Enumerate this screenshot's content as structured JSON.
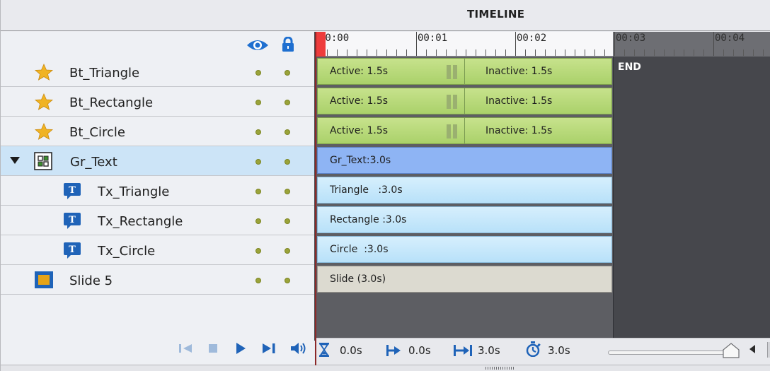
{
  "panel": {
    "title": "TIMELINE"
  },
  "header_icons": {
    "visibility": "eye-icon",
    "lock": "lock-icon"
  },
  "ruler": {
    "ticks": [
      "00:00",
      "00:01",
      "00:02",
      "00:03",
      "00:04"
    ]
  },
  "end_label": "END",
  "layers": [
    {
      "name": "Bt_Triangle",
      "icon": "star-icon",
      "indent": 0
    },
    {
      "name": "Bt_Rectangle",
      "icon": "star-icon",
      "indent": 0
    },
    {
      "name": "Bt_Circle",
      "icon": "star-icon",
      "indent": 0
    },
    {
      "name": "Gr_Text",
      "icon": "group-icon",
      "indent": 0,
      "expanded": true,
      "selected": true
    },
    {
      "name": "Tx_Triangle",
      "icon": "text-caption-icon",
      "indent": 1
    },
    {
      "name": "Tx_Rectangle",
      "icon": "text-caption-icon",
      "indent": 1
    },
    {
      "name": "Tx_Circle",
      "icon": "text-caption-icon",
      "indent": 1
    },
    {
      "name": "Slide 5",
      "icon": "slide-icon",
      "indent": 0
    }
  ],
  "bars": [
    {
      "active": "Active: 1.5s",
      "inactive": "Inactive: 1.5s"
    },
    {
      "active": "Active: 1.5s",
      "inactive": "Inactive: 1.5s"
    },
    {
      "active": "Active: 1.5s",
      "inactive": "Inactive: 1.5s"
    },
    {
      "label": "Gr_Text:3.0s"
    },
    {
      "label": "Triangle   :3.0s"
    },
    {
      "label": "Rectangle :3.0s"
    },
    {
      "label": "Circle  :3.0s"
    },
    {
      "label": "Slide (3.0s)"
    }
  ],
  "controls": {
    "current_time": "0.0s",
    "start_time": "0.0s",
    "duration": "3.0s",
    "slide_duration": "3.0s"
  },
  "colors": {
    "playhead": "#ee3c3c",
    "state_bar": "#b5d77a",
    "group_bar": "#8eb4f4",
    "text_bar": "#c6e8fb",
    "slide_bar": "#dcdad0",
    "star": "#f0b323",
    "accent": "#1e6fd0"
  }
}
